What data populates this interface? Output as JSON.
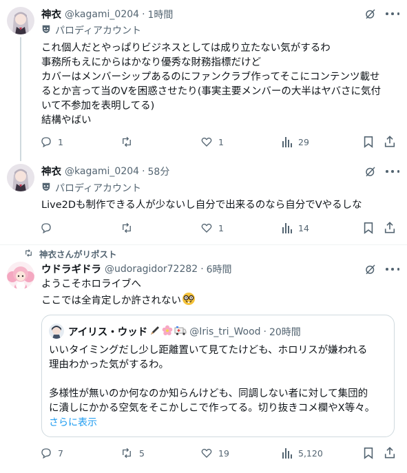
{
  "tweets": [
    {
      "name": "神衣",
      "handle": "@kagami_0204",
      "time": "1時間",
      "badge": "パロディアカウント",
      "lines": [
        "これ個人だとやっぱりビジネスとしては成り立たない気がするわ",
        "事務所もえにからはかなり優秀な財務指標だけど",
        "カバーはメンバーシップあるのにファンクラブ作ってそこにコンテンツ載せ",
        "るとか言って当のVを困惑させたり(事実主要メンバーの大半はヤバさに気付",
        "いて不参加を表明してる)",
        "結構やばい"
      ],
      "replies": "1",
      "retweets": "",
      "likes": "1",
      "views": "29"
    },
    {
      "name": "神衣",
      "handle": "@kagami_0204",
      "time": "58分",
      "badge": "パロディアカウント",
      "lines": [
        "Live2Dも制作できる人が少ないし自分で出来るのなら自分でVやるしな"
      ],
      "replies": "",
      "retweets": "",
      "likes": "1",
      "views": "14"
    },
    {
      "repost_label": "神衣さんがリポスト",
      "name": "ウドラギドラ",
      "handle": "@udoragidor72282",
      "time": "6時間",
      "lines": [
        "ようこそホロライブへ",
        "ここでは全肯定しか許されない"
      ],
      "emoji": "nerd-face",
      "replies": "7",
      "retweets": "5",
      "likes": "19",
      "views": "5,120",
      "quote": {
        "name": "アイリス・ウッド",
        "handle": "@Iris_tri_Wood",
        "time": "20時間",
        "lines": [
          "いいタイミングだし少し距離置いて見てたけども、ホロリスが嫌われる",
          "理由わかった気がするわ。",
          "",
          "多様性が無いのか何なのか知らんけども、同調しない者に対して集団的",
          "に潰しにかかる空気をそこかしこで作ってる。切り抜きコメ欄やX等々。"
        ],
        "show_more": "さらに表示"
      }
    }
  ],
  "separator": "·",
  "colors": {
    "text": "#0f1419",
    "muted": "#536471",
    "link": "#1d9bf0",
    "border": "#cfd9de"
  }
}
